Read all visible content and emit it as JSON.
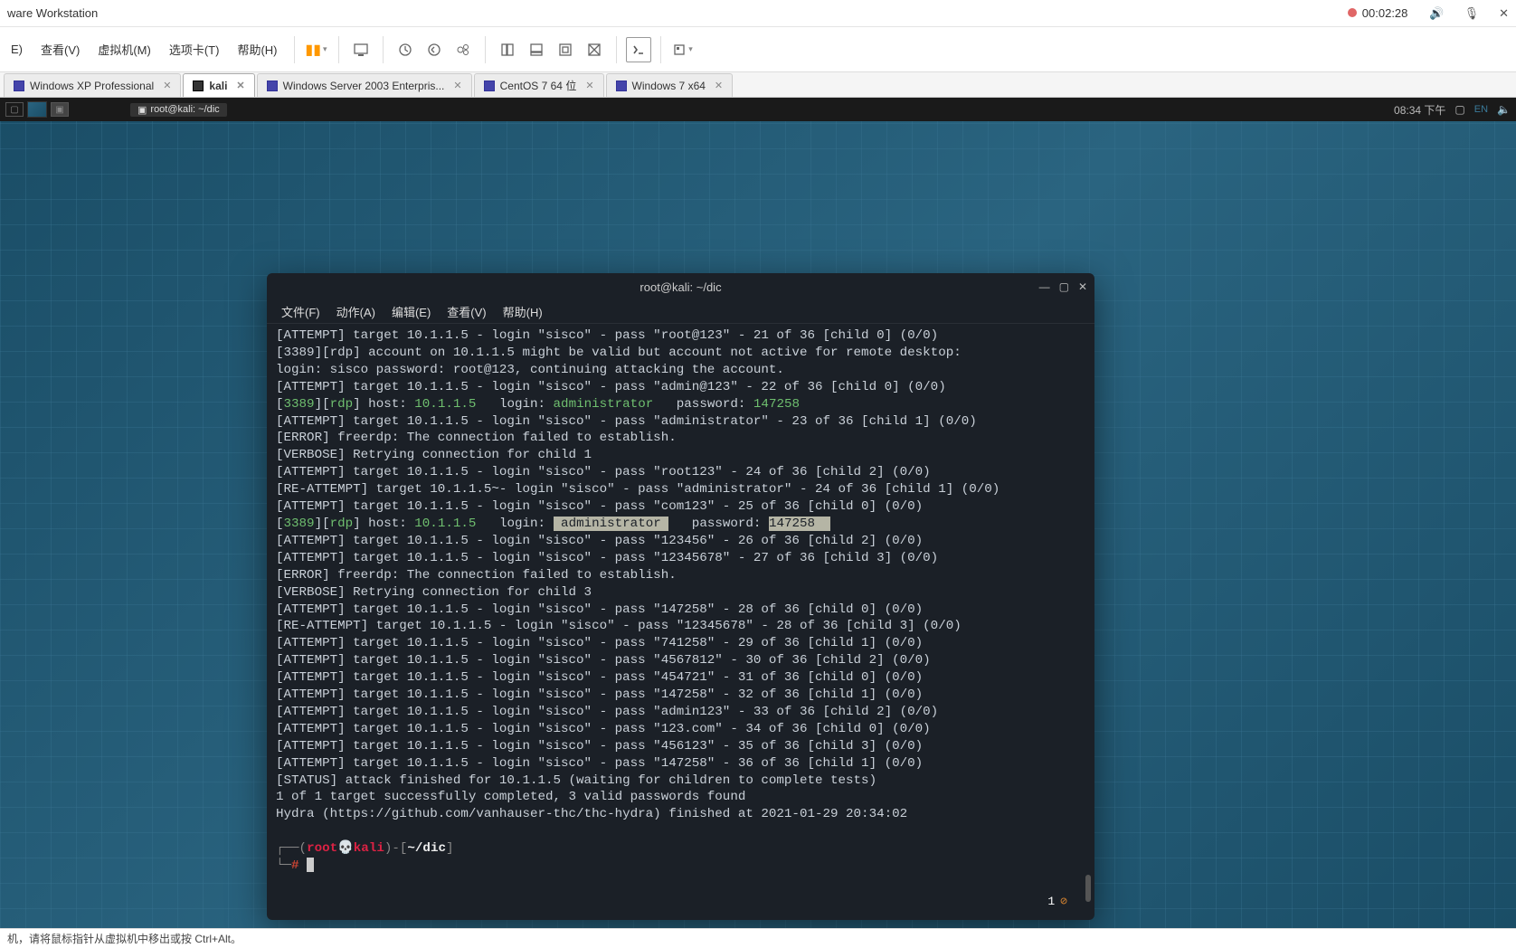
{
  "window": {
    "title_suffix": "ware Workstation",
    "recording_time": "00:02:28"
  },
  "menus": {
    "e": "E)",
    "view": "查看(V)",
    "vm": "虚拟机(M)",
    "tabs": "选项卡(T)",
    "help": "帮助(H)"
  },
  "vm_tabs": [
    {
      "label": "Windows XP Professional",
      "active": false
    },
    {
      "label": "kali",
      "active": true
    },
    {
      "label": "Windows Server 2003 Enterpris...",
      "active": false
    },
    {
      "label": "CentOS 7 64 位",
      "active": false
    },
    {
      "label": "Windows 7 x64",
      "active": false
    }
  ],
  "kali_panel": {
    "task": "root@kali: ~/dic",
    "clock": "08:34 下午",
    "lang": "EN"
  },
  "terminal": {
    "title": "root@kali: ~/dic",
    "menus": {
      "file": "文件(F)",
      "action": "动作(A)",
      "edit": "编辑(E)",
      "view": "查看(V)",
      "help": "帮助(H)"
    },
    "lines": [
      {
        "t": "plain",
        "text": "[ATTEMPT] target 10.1.1.5 - login \"sisco\" - pass \"root@123\" - 21 of 36 [child 0] (0/0)"
      },
      {
        "t": "plain",
        "text": "[3389][rdp] account on 10.1.1.5 might be valid but account not active for remote desktop: login: sisco password: root@123, continuing attacking the account."
      },
      {
        "t": "plain",
        "text": "[ATTEMPT] target 10.1.1.5 - login \"sisco\" - pass \"admin@123\" - 22 of 36 [child 0] (0/0)"
      },
      {
        "t": "found",
        "port": "3389",
        "proto": "rdp",
        "host": "10.1.1.5",
        "login": "administrator",
        "password": "147258",
        "sel": false
      },
      {
        "t": "plain",
        "text": "[ATTEMPT] target 10.1.1.5 - login \"sisco\" - pass \"administrator\" - 23 of 36 [child 1] (0/0)"
      },
      {
        "t": "plain",
        "text": "[ERROR] freerdp: The connection failed to establish."
      },
      {
        "t": "plain",
        "text": "[VERBOSE] Retrying connection for child 1"
      },
      {
        "t": "plain",
        "text": "[ATTEMPT] target 10.1.1.5 - login \"sisco\" - pass \"root123\" - 24 of 36 [child 2] (0/0)"
      },
      {
        "t": "plain",
        "text": "[RE-ATTEMPT] target 10.1.1.5~- login \"sisco\" - pass \"administrator\" - 24 of 36 [child 1] (0/0)"
      },
      {
        "t": "plain",
        "text": "[ATTEMPT] target 10.1.1.5 - login \"sisco\" - pass \"com123\" - 25 of 36 [child 0] (0/0)"
      },
      {
        "t": "found",
        "port": "3389",
        "proto": "rdp",
        "host": "10.1.1.5",
        "login": "administrator",
        "password": "147258",
        "sel": true
      },
      {
        "t": "plain",
        "text": "[ATTEMPT] target 10.1.1.5 - login \"sisco\" - pass \"123456\" - 26 of 36 [child 2] (0/0)"
      },
      {
        "t": "plain",
        "text": "[ATTEMPT] target 10.1.1.5 - login \"sisco\" - pass \"12345678\" - 27 of 36 [child 3] (0/0)"
      },
      {
        "t": "plain",
        "text": "[ERROR] freerdp: The connection failed to establish."
      },
      {
        "t": "plain",
        "text": "[VERBOSE] Retrying connection for child 3"
      },
      {
        "t": "plain",
        "text": "[ATTEMPT] target 10.1.1.5 - login \"sisco\" - pass \"147258\" - 28 of 36 [child 0] (0/0)"
      },
      {
        "t": "plain",
        "text": "[RE-ATTEMPT] target 10.1.1.5 - login \"sisco\" - pass \"12345678\" - 28 of 36 [child 3] (0/0)"
      },
      {
        "t": "plain",
        "text": "[ATTEMPT] target 10.1.1.5 - login \"sisco\" - pass \"741258\" - 29 of 36 [child 1] (0/0)"
      },
      {
        "t": "plain",
        "text": "[ATTEMPT] target 10.1.1.5 - login \"sisco\" - pass \"4567812\" - 30 of 36 [child 2] (0/0)"
      },
      {
        "t": "plain",
        "text": "[ATTEMPT] target 10.1.1.5 - login \"sisco\" - pass \"454721\" - 31 of 36 [child 0] (0/0)"
      },
      {
        "t": "plain",
        "text": "[ATTEMPT] target 10.1.1.5 - login \"sisco\" - pass \"147258\" - 32 of 36 [child 1] (0/0)"
      },
      {
        "t": "plain",
        "text": "[ATTEMPT] target 10.1.1.5 - login \"sisco\" - pass \"admin123\" - 33 of 36 [child 2] (0/0)"
      },
      {
        "t": "plain",
        "text": "[ATTEMPT] target 10.1.1.5 - login \"sisco\" - pass \"123.com\" - 34 of 36 [child 0] (0/0)"
      },
      {
        "t": "plain",
        "text": "[ATTEMPT] target 10.1.1.5 - login \"sisco\" - pass \"456123\" - 35 of 36 [child 3] (0/0)"
      },
      {
        "t": "plain",
        "text": "[ATTEMPT] target 10.1.1.5 - login \"sisco\" - pass \"147258\" - 36 of 36 [child 1] (0/0)"
      },
      {
        "t": "plain",
        "text": "[STATUS] attack finished for 10.1.1.5 (waiting for children to complete tests)"
      },
      {
        "t": "plain",
        "text": "1 of 1 target successfully completed, 3 valid passwords found"
      },
      {
        "t": "plain",
        "text": "Hydra (https://github.com/vanhauser-thc/thc-hydra) finished at 2021-01-29 20:34:02"
      }
    ],
    "prompt": {
      "user": "root",
      "host": "kali",
      "path": "~/dic",
      "symbol": "#"
    },
    "exit_indicator": "1"
  },
  "status": "机，请将鼠标指针从虚拟机中移出或按 Ctrl+Alt。"
}
